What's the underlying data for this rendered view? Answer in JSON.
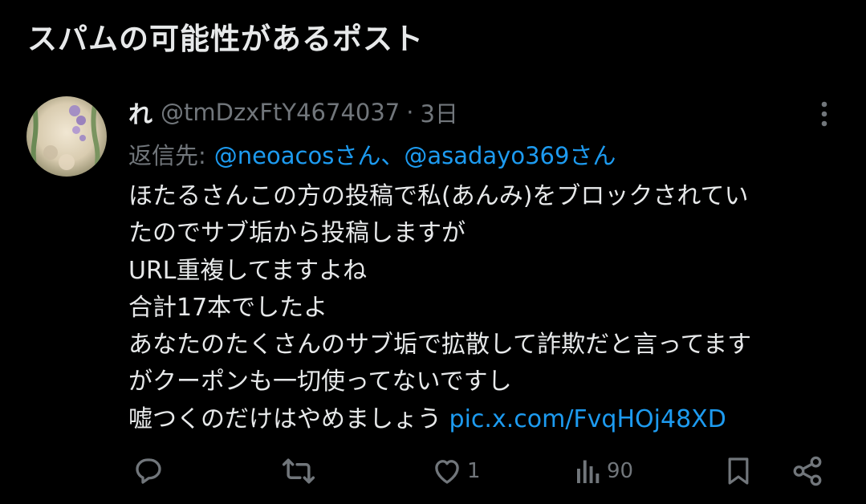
{
  "section_title": "スパムの可能性があるポスト",
  "post": {
    "display_name": "れ",
    "handle": "@tmDzxFtY4674037",
    "separator": "·",
    "time": "3日",
    "reply_to_label": "返信先:",
    "reply_mentions": [
      "@neoacosさん",
      "@asadayo369さん"
    ],
    "reply_separator": "、",
    "body_lines": [
      "ほたるさんこの方の投稿で私(あんみ)をブロックされてい",
      "たのでサブ垢から投稿しますが",
      "URL重複してますよね",
      "合計17本でしたよ",
      "あなたのたくさんのサブ垢で拡散して詐欺だと言ってます",
      "がクーポンも一切使ってないですし",
      "嘘つくのだけはやめましょう"
    ],
    "link": "pic.x.com/FvqHOj48XD"
  },
  "actions": {
    "reply_count": "",
    "repost_count": "",
    "like_count": "1",
    "views_count": "90"
  },
  "colors": {
    "background": "#000000",
    "text": "#e7e9ea",
    "muted": "#71767b",
    "accent": "#1d9bf0"
  },
  "icons": [
    "more-icon",
    "reply-icon",
    "repost-icon",
    "like-icon",
    "views-icon",
    "bookmark-icon",
    "share-icon"
  ]
}
